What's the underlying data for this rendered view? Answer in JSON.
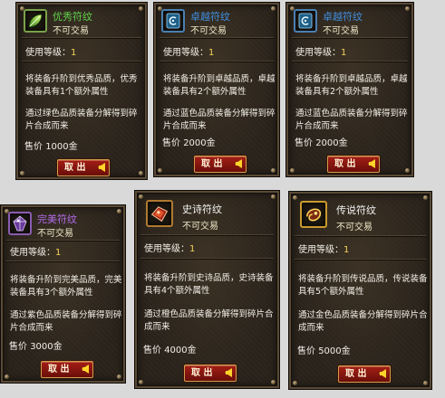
{
  "level_label": "使用等级：",
  "level_value": "1",
  "price_label": "售价",
  "button_label": "取 出",
  "cards": [
    {
      "name": "优秀符纹",
      "name_color": "#5fd24a",
      "trade": "不可交易",
      "icon": "green-leaf-rune-icon",
      "desc1": "将装备升阶到优秀品质，优秀装备具有1个额外属性",
      "desc2": "通过绿色品质装备分解得到碎片合成而来",
      "price": "1000金"
    },
    {
      "name": "卓越符纹",
      "name_color": "#3f8fe0",
      "trade": "不可交易",
      "icon": "blue-scroll-rune-icon",
      "desc1": "将装备升阶到卓越品质，卓越装备具有2个额外属性",
      "desc2": "通过蓝色品质装备分解得到碎片合成而来",
      "price": "2000金"
    },
    {
      "name": "卓越符纹",
      "name_color": "#3f8fe0",
      "trade": "不可交易",
      "icon": "blue-scroll-rune-icon",
      "desc1": "将装备升阶到卓越品质，卓越装备具有2个额外属性",
      "desc2": "通过蓝色品质装备分解得到碎片合成而来",
      "price": "2000金"
    },
    {
      "name": "完美符纹",
      "name_color": "#b06ae8",
      "trade": "不可交易",
      "icon": "purple-crystal-rune-icon",
      "desc1": "将装备升阶到完美品质，完美装备具有3个额外属性",
      "desc2": "通过紫色品质装备分解得到碎片合成而来",
      "price": "3000金"
    },
    {
      "name": "史诗符纹",
      "name_color": "#f2f2f2",
      "trade": "不可交易",
      "icon": "red-gem-rune-icon",
      "desc1": "将装备升阶到史诗品质，史诗装备具有4个额外属性",
      "desc2": "通过橙色品质装备分解得到碎片合成而来",
      "price": "4000金"
    },
    {
      "name": "传说符纹",
      "name_color": "#f2f2f2",
      "trade": "不可交易",
      "icon": "gold-swirl-rune-icon",
      "desc1": "将装备升阶到传说品质，传说装备具有5个额外属性",
      "desc2": "通过金色品质装备分解得到碎片合成而来",
      "price": "5000金"
    }
  ]
}
